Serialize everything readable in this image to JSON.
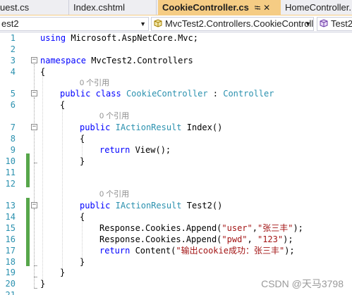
{
  "tabs": [
    {
      "label": "uest.cs",
      "active": false
    },
    {
      "label": "Index.cshtml",
      "active": false
    },
    {
      "label": "CookieController.cs",
      "active": true,
      "pin_icon": "pin-icon",
      "close_icon": "close-icon"
    },
    {
      "label": "HomeController.",
      "active": false
    }
  ],
  "navbar": {
    "project": "est2",
    "type": "MvcTest2.Controllers.CookieControll",
    "member": "Test2"
  },
  "gutter": {
    "fold_minus": "−"
  },
  "code_lines": [
    {
      "n": "1",
      "tokens": [
        {
          "t": "using",
          "c": "kw"
        },
        {
          "t": " Microsoft.AspNetCore.Mvc;",
          "c": ""
        }
      ]
    },
    {
      "n": "2",
      "tokens": []
    },
    {
      "n": "3",
      "tokens": [
        {
          "t": "namespace",
          "c": "kw"
        },
        {
          "t": " MvcTest2.Controllers",
          "c": ""
        }
      ]
    },
    {
      "n": "4",
      "tokens": [
        {
          "t": "{",
          "c": ""
        }
      ]
    },
    {
      "n": "",
      "hint": "0 个引用"
    },
    {
      "n": "5",
      "tokens": [
        {
          "t": "public",
          "c": "kw"
        },
        {
          "t": " ",
          "c": ""
        },
        {
          "t": "class",
          "c": "kw"
        },
        {
          "t": " ",
          "c": ""
        },
        {
          "t": "CookieController",
          "c": "ty"
        },
        {
          "t": " : ",
          "c": ""
        },
        {
          "t": "Controller",
          "c": "ty"
        }
      ]
    },
    {
      "n": "6",
      "tokens": [
        {
          "t": "{",
          "c": ""
        }
      ]
    },
    {
      "n": "",
      "hint": "0 个引用"
    },
    {
      "n": "7",
      "tokens": [
        {
          "t": "public",
          "c": "kw"
        },
        {
          "t": " ",
          "c": ""
        },
        {
          "t": "IActionResult",
          "c": "ty"
        },
        {
          "t": " Index()",
          "c": ""
        }
      ]
    },
    {
      "n": "8",
      "tokens": [
        {
          "t": "{",
          "c": ""
        }
      ]
    },
    {
      "n": "9",
      "tokens": [
        {
          "t": "return",
          "c": "kw"
        },
        {
          "t": " View();",
          "c": ""
        }
      ]
    },
    {
      "n": "10",
      "tokens": [
        {
          "t": "}",
          "c": ""
        }
      ]
    },
    {
      "n": "11",
      "tokens": []
    },
    {
      "n": "12",
      "tokens": []
    },
    {
      "n": "",
      "hint": "0 个引用"
    },
    {
      "n": "13",
      "tokens": [
        {
          "t": "public",
          "c": "kw"
        },
        {
          "t": " ",
          "c": ""
        },
        {
          "t": "IActionResult",
          "c": "ty"
        },
        {
          "t": " Test2()",
          "c": ""
        }
      ]
    },
    {
      "n": "14",
      "tokens": [
        {
          "t": "{",
          "c": ""
        }
      ]
    },
    {
      "n": "15",
      "tokens": [
        {
          "t": "Response.Cookies.Append(",
          "c": ""
        },
        {
          "t": "\"user\"",
          "c": "st"
        },
        {
          "t": ",",
          "c": ""
        },
        {
          "t": "\"张三丰\"",
          "c": "st"
        },
        {
          "t": ");",
          "c": ""
        }
      ]
    },
    {
      "n": "16",
      "tokens": [
        {
          "t": "Response.Cookies.Append(",
          "c": ""
        },
        {
          "t": "\"pwd\"",
          "c": "st"
        },
        {
          "t": ", ",
          "c": ""
        },
        {
          "t": "\"123\"",
          "c": "st"
        },
        {
          "t": ");",
          "c": ""
        }
      ]
    },
    {
      "n": "17",
      "tokens": [
        {
          "t": "return",
          "c": "kw"
        },
        {
          "t": " Content(",
          "c": ""
        },
        {
          "t": "\"输出cookie成功：张三丰\"",
          "c": "st"
        },
        {
          "t": ");",
          "c": ""
        }
      ]
    },
    {
      "n": "18",
      "tokens": [
        {
          "t": "}",
          "c": ""
        }
      ]
    },
    {
      "n": "19",
      "tokens": [
        {
          "t": "}",
          "c": ""
        }
      ]
    },
    {
      "n": "20",
      "tokens": [
        {
          "t": "}",
          "c": ""
        }
      ]
    },
    {
      "n": "21",
      "tokens": []
    }
  ],
  "watermark": "CSDN @天马3798",
  "colors": {
    "keyword": "#0000ff",
    "type": "#2b91af",
    "string": "#a31515",
    "active_tab": "#f5cc84",
    "change_bar": "#57a64a"
  }
}
